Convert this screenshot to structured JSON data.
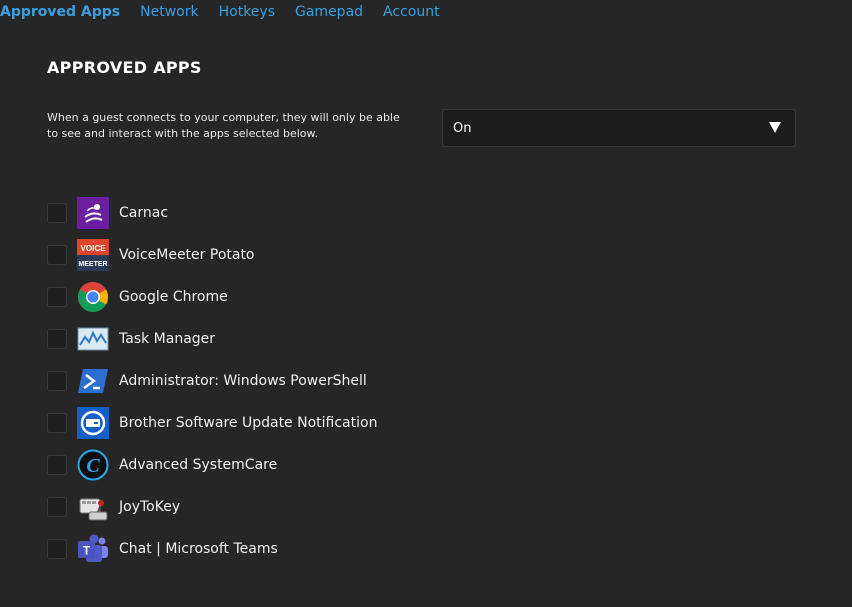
{
  "tabs": [
    {
      "label": "Approved Apps",
      "active": true
    },
    {
      "label": "Network"
    },
    {
      "label": "Hotkeys"
    },
    {
      "label": "Gamepad"
    },
    {
      "label": "Account"
    }
  ],
  "section": {
    "title": "APPROVED APPS",
    "description": "When a guest connects to your computer, they will only be able to see and interact with the apps selected below."
  },
  "mode_select": {
    "value": "On"
  },
  "apps": [
    {
      "name": "Carnac",
      "icon": "carnac-icon",
      "checked": false
    },
    {
      "name": "VoiceMeeter Potato",
      "icon": "voicemeeter-icon",
      "checked": false
    },
    {
      "name": "Google Chrome",
      "icon": "chrome-icon",
      "checked": false
    },
    {
      "name": "Task Manager",
      "icon": "task-manager-icon",
      "checked": false
    },
    {
      "name": "Administrator: Windows PowerShell",
      "icon": "powershell-icon",
      "checked": false
    },
    {
      "name": "Brother Software Update Notification",
      "icon": "brother-icon",
      "checked": false
    },
    {
      "name": "Advanced SystemCare",
      "icon": "systemcare-icon",
      "checked": false
    },
    {
      "name": "JoyToKey",
      "icon": "joytokey-icon",
      "checked": false
    },
    {
      "name": "Chat | Microsoft Teams",
      "icon": "teams-icon",
      "checked": false
    }
  ],
  "colors": {
    "background": "#262626",
    "accent": "#3a9fde"
  }
}
